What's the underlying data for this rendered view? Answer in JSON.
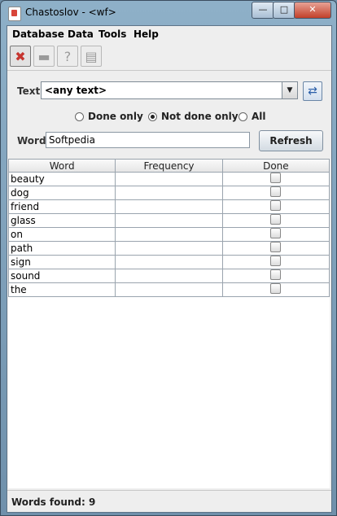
{
  "window": {
    "title": "Chastoslov - <wf>",
    "minimize": "—",
    "maximize": "□",
    "close": "✕"
  },
  "menubar": {
    "items": [
      "Database",
      "Data",
      "Tools",
      "Help"
    ]
  },
  "toolbar": {
    "icons": [
      "connect-icon",
      "open-folder-icon",
      "help-icon",
      "book-icon"
    ]
  },
  "filter": {
    "text_label": "Text",
    "text_value": "<any text>",
    "radios": [
      {
        "label": "Done only",
        "checked": false
      },
      {
        "label": "Not done only",
        "checked": true
      },
      {
        "label": "All",
        "checked": false
      }
    ],
    "word_label": "Word",
    "word_value": "Softpedia",
    "refresh_label": "Refresh"
  },
  "table": {
    "columns": [
      "Word",
      "Frequency",
      "Done"
    ],
    "rows": [
      {
        "word": "beauty",
        "frequency": "",
        "done": false
      },
      {
        "word": "dog",
        "frequency": "",
        "done": false
      },
      {
        "word": "friend",
        "frequency": "",
        "done": false
      },
      {
        "word": "glass",
        "frequency": "",
        "done": false
      },
      {
        "word": "on",
        "frequency": "",
        "done": false
      },
      {
        "word": "path",
        "frequency": "",
        "done": false
      },
      {
        "word": "sign",
        "frequency": "",
        "done": false
      },
      {
        "word": "sound",
        "frequency": "",
        "done": false
      },
      {
        "word": "the",
        "frequency": "",
        "done": false
      }
    ]
  },
  "status": {
    "text": "Words found: 9"
  }
}
